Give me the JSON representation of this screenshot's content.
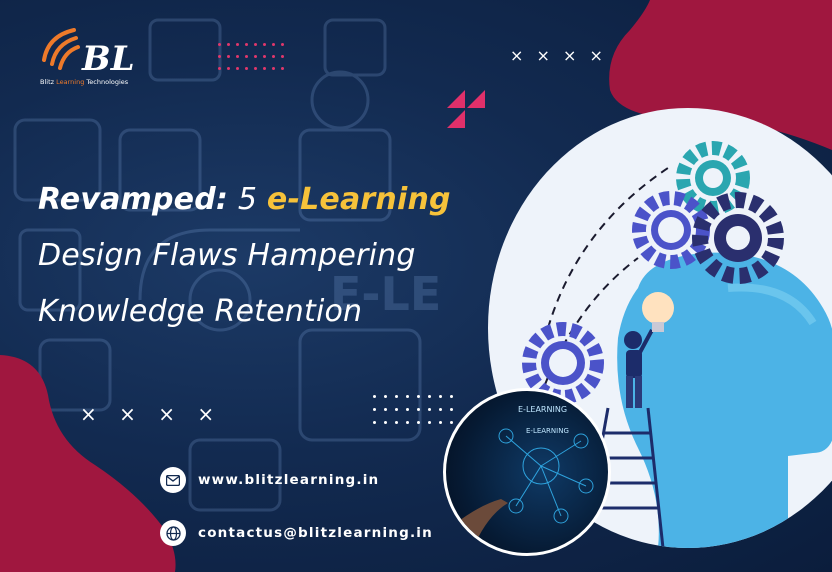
{
  "brand": {
    "logo_text": "BL",
    "tagline_part1": "Blitz",
    "tagline_part2": "Learning",
    "tagline_part3": "Technologies"
  },
  "headline": {
    "line1_part1": "Revamped:",
    "line1_part2": "5",
    "line1_part3": "e-Learning",
    "line2": "Design Flaws Hampering",
    "line3": "Knowledge Retention"
  },
  "decor": {
    "x_marks_top": "× × × ×",
    "x_marks_bottom": "× × × ×",
    "bg_watermark_text": "E-LE"
  },
  "contacts": [
    {
      "icon": "mail-icon",
      "text": "www.blitzlearning.in"
    },
    {
      "icon": "globe-icon",
      "text": "contactus@blitzlearning.in"
    }
  ],
  "illustration": {
    "small_circle_label1": "E-LEARNING",
    "small_circle_label2": "E-LEARNING"
  },
  "colors": {
    "navy": "#122a50",
    "crimson": "#a0173f",
    "yellow": "#f6c23a",
    "orange": "#ee7a2a",
    "gear_blue": "#4b53c9",
    "gear_teal": "#2aa6b0",
    "head_blue": "#4cb3e6"
  }
}
